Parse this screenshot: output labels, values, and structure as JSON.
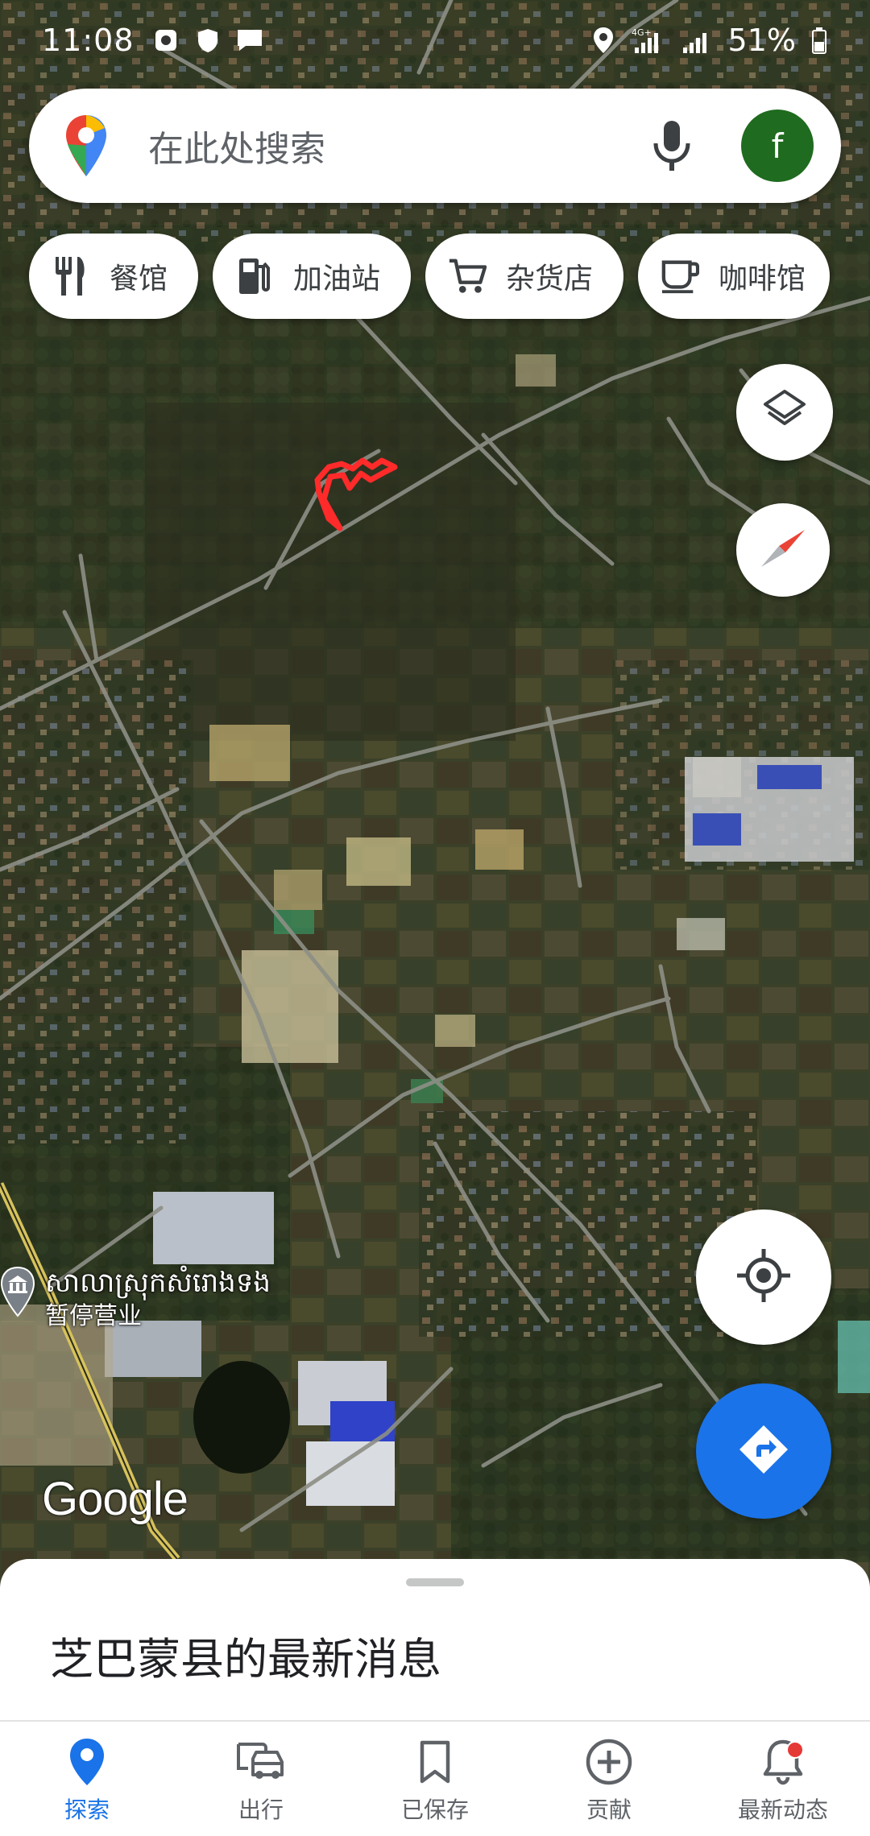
{
  "status_bar": {
    "time": "11:08",
    "battery": "51%",
    "network": "4G+"
  },
  "search": {
    "placeholder": "在此处搜索",
    "avatar_letter": "f",
    "avatar_color": "#1f6b1f"
  },
  "chips": [
    {
      "label": "餐馆",
      "icon": "restaurant-icon"
    },
    {
      "label": "加油站",
      "icon": "gas-station-icon"
    },
    {
      "label": "杂货店",
      "icon": "grocery-cart-icon"
    },
    {
      "label": "咖啡馆",
      "icon": "cafe-icon"
    }
  ],
  "map": {
    "type": "satellite",
    "place": {
      "name": "សាលាស្រុកសំរោងទង",
      "status": "暂停营业"
    },
    "attribution": "Google",
    "marker_color": "#ff2a2a"
  },
  "sheet": {
    "title": "芝巴蒙县的最新消息"
  },
  "nav": {
    "items": [
      {
        "label": "探索",
        "icon": "explore-pin-icon",
        "active": true
      },
      {
        "label": "出行",
        "icon": "commute-icon",
        "active": false
      },
      {
        "label": "已保存",
        "icon": "bookmark-icon",
        "active": false
      },
      {
        "label": "贡献",
        "icon": "add-circle-icon",
        "active": false
      },
      {
        "label": "最新动态",
        "icon": "bell-icon",
        "active": false,
        "badge": true
      }
    ],
    "active_color": "#1a73e8"
  }
}
